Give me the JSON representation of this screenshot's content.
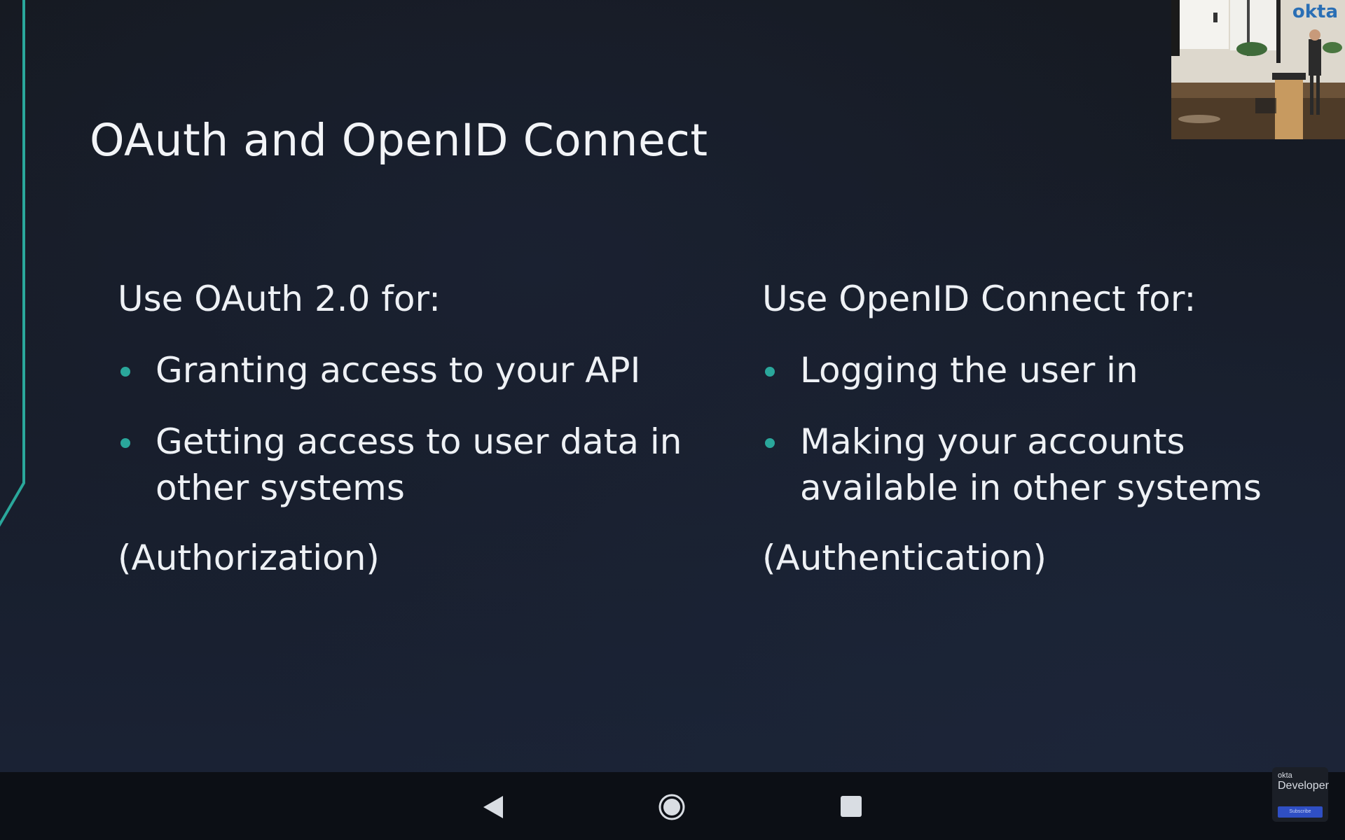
{
  "slide": {
    "title": "OAuth and OpenID Connect",
    "left_column": {
      "heading": "Use OAuth 2.0 for:",
      "bullets": [
        "Granting access to your API",
        "Getting access to user data in other systems"
      ],
      "note": "(Authorization)"
    },
    "right_column": {
      "heading": "Use OpenID Connect for:",
      "bullets": [
        "Logging the user in",
        "Making your accounts available in other systems"
      ],
      "note": "(Authentication)"
    }
  },
  "speaker_video": {
    "logo_text": "okta"
  },
  "watermark": {
    "brand": "okta",
    "title": "Developer",
    "button_label": "Subscribe"
  },
  "icons": {
    "nav_back": "back-triangle-icon",
    "nav_home": "home-circle-icon",
    "nav_recents": "recents-square-icon"
  },
  "colors": {
    "accent_teal": "#2aa79b",
    "slide_background": "#171d2a",
    "nav_bar": "#0c0f15",
    "text": "#eef1f5"
  }
}
